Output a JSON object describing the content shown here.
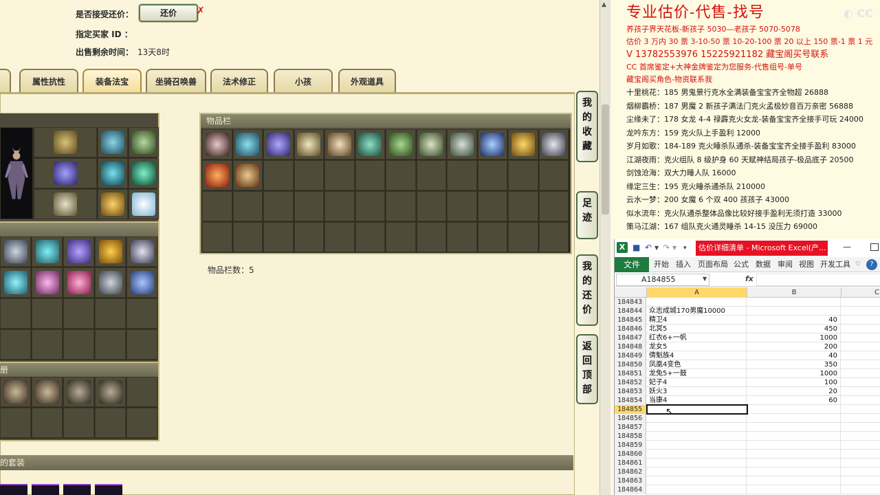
{
  "game": {
    "accept_counter_label": "是否接受还价：",
    "counter_button": "还价",
    "counter_x": "✗",
    "buyer_id_label": "指定买家 ID ：",
    "time_left_label": "出售剩余时间：",
    "time_left_value": "13天8时",
    "tabs": [
      "属性抗性",
      "装备法宝",
      "坐骑召唤兽",
      "法术修正",
      "小孩",
      "外观道具"
    ],
    "active_tab": "装备法宝",
    "inventory_title": "物品栏",
    "item_count_label": "物品栏数：5",
    "left_section_title": "册",
    "bottom_section_title": "的套装",
    "side_buttons": [
      "我的收藏",
      "足迹",
      "我的还价",
      "返回顶部"
    ]
  },
  "info": {
    "title": "专业估价-代售-找号",
    "red_lines": [
      "养孩子界天花板-新孩子 5030—老孩子 5070-5078",
      "估价 3 万内 30 票 3-10-50 票 10-20-100 票 20 以上 150 票-1 票 1 元",
      "V 13782553976    15225921182  藏宝阁买号联系",
      "CC 首席鉴定+大神金牌鉴定为您服务-代售组号-单号",
      "藏宝阁买角色-物资联系我"
    ],
    "black_lines": [
      "十里桃花：185 男鬼景行克水全满装备宝宝齐全物超 26888",
      "烟柳霸桥：187 男魔 2 新孩子满法门克火孟极妙音百万亲密 56888",
      "尘缘未了：178 女龙 4-4 禄霹克火女龙-装备宝宝齐全接手可玩 24000",
      "龙吟东方：159 克火队上手盈利 12000",
      "岁月如歌：184-189 克火睡杀队通杀-装备宝宝齐全接手盈利 83000",
      "江湖夜雨：克火组队 8 级护身 60 天赋神结局孩子-极品底子 20500",
      "剑蚀沧海：双大力睡人队 16000",
      "缘定三生：195 克火睡杀通杀队 210000",
      "云水一梦：200 女魔 6 个双 400 孩孩子 43000",
      "似水流年：克火队通杀整体品像比较好接手盈利无须打造 33000",
      "策马江湖：167 组队克火通灵睡杀 14-15 没压力 69000"
    ]
  },
  "excel": {
    "title": "估价详细清单 - Microsoft Excel(产...",
    "file_tab": "文件",
    "ribbon_tabs": [
      "开始",
      "插入",
      "页面布局",
      "公式",
      "数据",
      "审阅",
      "视图",
      "开发工具"
    ],
    "name_box": "A184855",
    "fx": "fx",
    "columns": [
      "A",
      "B",
      "C"
    ],
    "rows": [
      {
        "n": "184843",
        "a": "",
        "b": ""
      },
      {
        "n": "184844",
        "a": "众志成城170男魔10000",
        "b": ""
      },
      {
        "n": "184845",
        "a": "精卫4",
        "b": "40"
      },
      {
        "n": "184846",
        "a": "北冥5",
        "b": "450"
      },
      {
        "n": "184847",
        "a": "红衣6+一帆",
        "b": "1000"
      },
      {
        "n": "184848",
        "a": "龙女5",
        "b": "200"
      },
      {
        "n": "184849",
        "a": "倩魁族4",
        "b": "40"
      },
      {
        "n": "184850",
        "a": "凤凰4变色",
        "b": "350"
      },
      {
        "n": "184851",
        "a": "龙兔5+一鼓",
        "b": "1000"
      },
      {
        "n": "184852",
        "a": "妃子4",
        "b": "100"
      },
      {
        "n": "184853",
        "a": "妖火3",
        "b": "20"
      },
      {
        "n": "184854",
        "a": "当康4",
        "b": "60"
      },
      {
        "n": "184855",
        "a": "",
        "b": ""
      },
      {
        "n": "184856",
        "a": "",
        "b": ""
      },
      {
        "n": "184857",
        "a": "",
        "b": ""
      },
      {
        "n": "184858",
        "a": "",
        "b": ""
      },
      {
        "n": "184859",
        "a": "",
        "b": ""
      },
      {
        "n": "184860",
        "a": "",
        "b": ""
      },
      {
        "n": "184861",
        "a": "",
        "b": ""
      },
      {
        "n": "184862",
        "a": "",
        "b": ""
      },
      {
        "n": "184863",
        "a": "",
        "b": ""
      },
      {
        "n": "184864",
        "a": "",
        "b": ""
      }
    ]
  },
  "colors": {
    "red": "#d4110e",
    "excel_green": "#1f7a3e",
    "title_red": "#e81123",
    "selection": "#ffd86b"
  }
}
